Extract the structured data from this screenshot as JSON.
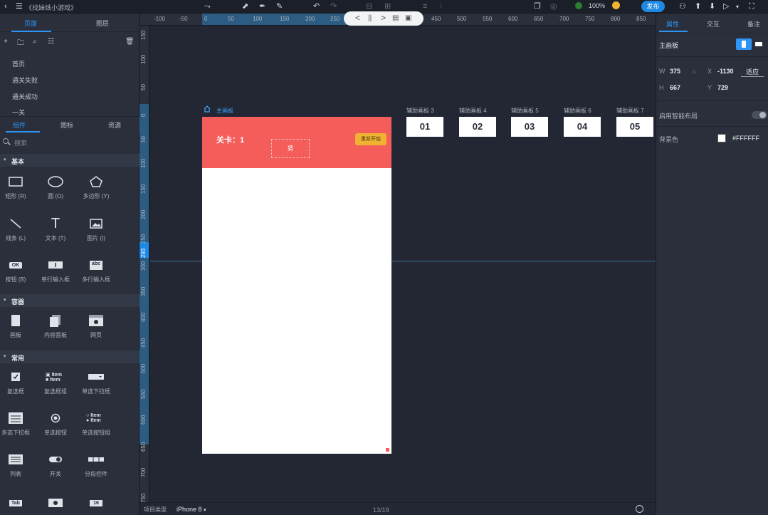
{
  "topbar": {
    "doc_title": "《找妹纸小游戏》",
    "zoom": "100%",
    "publish": "发布"
  },
  "float_toolbar": {
    "prev": "<",
    "pause": "||",
    "next": ">"
  },
  "left_panel": {
    "tabs": [
      "页面",
      "图层"
    ],
    "pages": [
      "首页",
      "通关失败",
      "通关成功",
      "一关"
    ],
    "lib_tabs": [
      "组件",
      "图标",
      "资源"
    ],
    "search_placeholder": "搜索",
    "sections": {
      "basic": "基本",
      "container": "容器",
      "common": "常用"
    },
    "basic_items": [
      "矩形 (R)",
      "圆 (O)",
      "多边形 (Y)",
      "线条 (L)",
      "文本 (T)",
      "图片 (I)",
      "按钮 (B)",
      "单行输入框",
      "多行输入框"
    ],
    "container_items": [
      "画板",
      "内容面板",
      "网页"
    ],
    "common_items": [
      "复选框",
      "复选框组",
      "单选下拉框",
      "多选下拉框",
      "单选按钮",
      "单选按钮组",
      "列表",
      "开关",
      "分段控件"
    ],
    "icon_texts": {
      "btn": "OK",
      "item1": "Item",
      "item2": "Item",
      "abc": "abc",
      "tab": "Tab",
      "num": "16"
    }
  },
  "ruler": {
    "top": [
      "-100",
      "-50",
      "0",
      "50",
      "100",
      "150",
      "200",
      "250",
      "450",
      "500",
      "550",
      "600",
      "650",
      "700",
      "750",
      "800",
      "850"
    ],
    "left": [
      "150",
      "100",
      "50",
      "0",
      "50",
      "100",
      "150",
      "200",
      "250",
      "300",
      "350",
      "400",
      "450",
      "500",
      "550",
      "600",
      "650",
      "700",
      "750"
    ],
    "marker": "293"
  },
  "canvas": {
    "main_board_label": "主画板",
    "level_text": "关卡：1",
    "restart": "重新开始",
    "placeholder_box": "猜",
    "aux_boards": [
      {
        "label": "辅助画板 3",
        "value": "01"
      },
      {
        "label": "辅助画板 4",
        "value": "02"
      },
      {
        "label": "辅助画板 5",
        "value": "03"
      },
      {
        "label": "辅助画板 6",
        "value": "04"
      },
      {
        "label": "辅助画板 7",
        "value": "05"
      }
    ]
  },
  "bottombar": {
    "project_type_label": "项目类型",
    "device": "iPhone 8",
    "page_counter": "13/19"
  },
  "right_panel": {
    "tabs": [
      "属性",
      "交互",
      "备注"
    ],
    "title": "主画板",
    "w_label": "W",
    "w_value": "375",
    "h_label": "H",
    "h_value": "667",
    "x_label": "X",
    "x_value": "-1130",
    "y_label": "Y",
    "y_value": "729",
    "fit": "适应",
    "smart_layout": "启用智能布局",
    "bg_label": "背景色",
    "bg_value": "#FFFFFF"
  },
  "colors": {
    "accent": "#2f95f5",
    "header_red": "#f45d5a",
    "button_yellow": "#f0b232"
  }
}
